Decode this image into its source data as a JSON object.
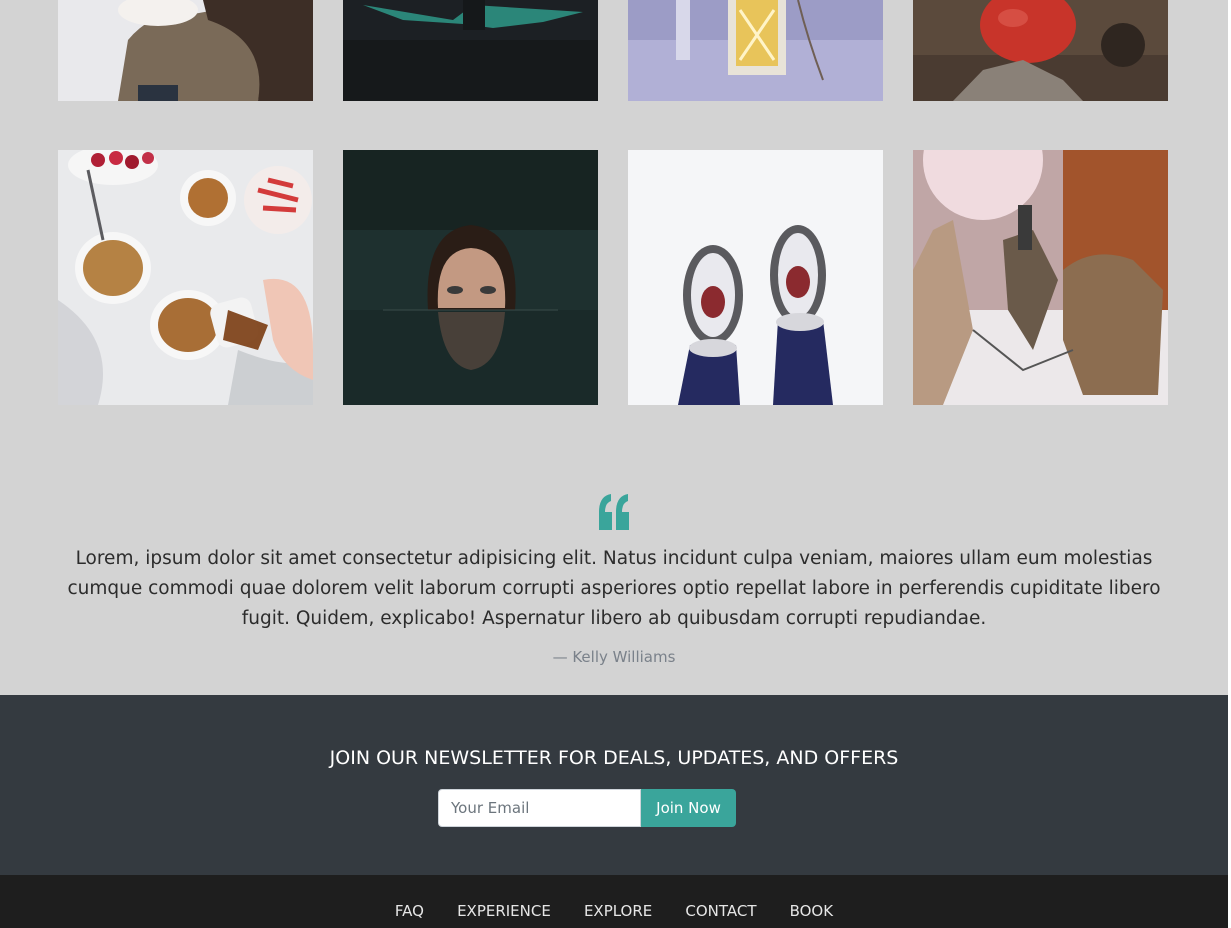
{
  "gallery": {
    "row1": [
      {
        "icon": "photo-hug-in-snow"
      },
      {
        "icon": "photo-aurora-lake"
      },
      {
        "icon": "photo-snowy-lantern"
      },
      {
        "icon": "photo-red-kettle-on-rocks"
      }
    ],
    "row2": [
      {
        "icon": "photo-oatmeal-breakfast"
      },
      {
        "icon": "photo-woman-in-water"
      },
      {
        "icon": "photo-snowshoes"
      },
      {
        "icon": "photo-sled-dogs"
      }
    ]
  },
  "testimonial": {
    "icon": "quote-icon",
    "accent_color": "#3aa59b",
    "text": "Lorem, ipsum dolor sit amet consectetur adipisicing elit. Natus incidunt culpa veniam, maiores ullam eum molestias cumque commodi quae dolorem velit laborum corrupti asperiores optio repellat labore in perferendis cupiditate libero fugit. Quidem, explicabo! Aspernatur libero ab quibusdam corrupti repudiandae.",
    "author": "— Kelly Williams"
  },
  "newsletter": {
    "heading": "JOIN OUR NEWSLETTER FOR DEALS, UPDATES, AND OFFERS",
    "email_placeholder": "Your Email",
    "email_value": "",
    "button_label": "Join Now",
    "background": "#343a40"
  },
  "footer": {
    "links": [
      "FAQ",
      "EXPERIENCE",
      "EXPLORE",
      "CONTACT",
      "BOOK"
    ],
    "background": "#1e1e1e"
  }
}
